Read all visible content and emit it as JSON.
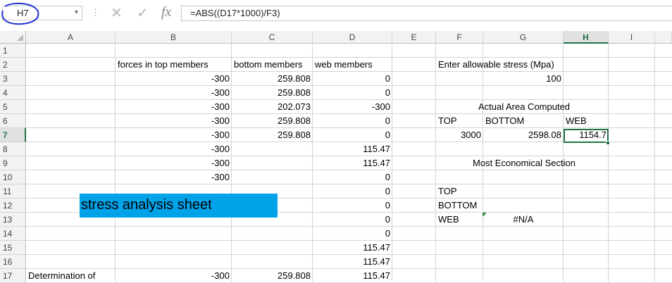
{
  "formula_bar": {
    "name_box": "H7",
    "formula": "=ABS((D17*1000)/F3)",
    "cancel_icon": "✕",
    "enter_icon": "✓",
    "fx_icon": "fx"
  },
  "columns": [
    "A",
    "B",
    "C",
    "D",
    "E",
    "F",
    "G",
    "H",
    "I"
  ],
  "rows": [
    "1",
    "2",
    "3",
    "4",
    "5",
    "6",
    "7",
    "8",
    "9",
    "10",
    "11",
    "12",
    "13",
    "14",
    "15",
    "16",
    "17"
  ],
  "cells": {
    "B2": "forces in top members",
    "C2": "bottom members",
    "D2": "web members",
    "F2": "Enter allowable stress (Mpa)",
    "B3": "-300",
    "C3": "259.808",
    "D3": "0",
    "G3": "100",
    "B4": "-300",
    "C4": "259.808",
    "D4": "0",
    "B5": "-300",
    "C5": "202.073",
    "D5": "-300",
    "F5": "Actual Area Computed",
    "B6": "-300",
    "C6": "259.808",
    "D6": "0",
    "F6": "TOP",
    "G6": "BOTTOM",
    "H6": "WEB",
    "B7": "-300",
    "C7": "259.808",
    "D7": "0",
    "F7": "3000",
    "G7": "2598.08",
    "H7": "1154.7",
    "B8": "-300",
    "D8": "115.47",
    "B9": "-300",
    "D9": "115.47",
    "F9": "Most Economical Section",
    "B10": "-300",
    "D10": "0",
    "D11": "0",
    "F11": "TOP",
    "D12": "0",
    "F12": "BOTTOM",
    "D13": "0",
    "F13": "WEB",
    "G13": "#N/A",
    "D14": "0",
    "D15": "115.47",
    "D16": "115.47",
    "A17": "Determination of",
    "B17": "-300",
    "C17": "259.808",
    "D17": "115.47"
  },
  "banner": {
    "text": "stress analysis sheet",
    "color": "#00a2e8"
  },
  "colors": {
    "accent": "#217346",
    "annotation_circle": "#1f2fd1"
  }
}
